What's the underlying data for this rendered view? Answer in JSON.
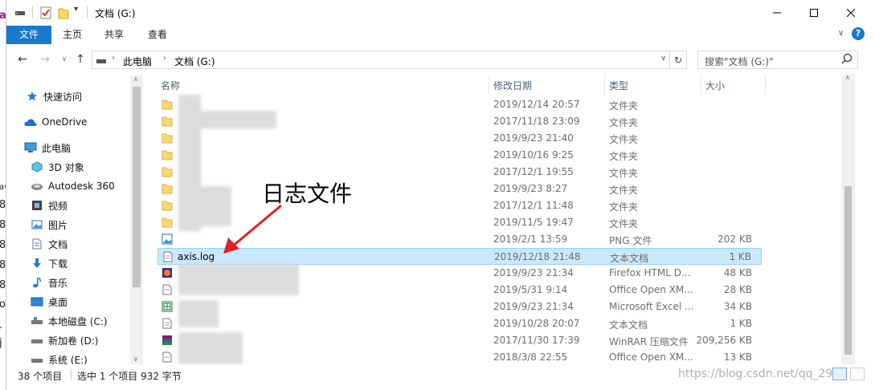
{
  "window": {
    "title": "文档 (G:)",
    "accent": "#1979ca"
  },
  "ribbon": {
    "tabs": [
      "文件",
      "主页",
      "共享",
      "查看"
    ]
  },
  "address": {
    "crumbs": [
      "此电脑",
      "文档 (G:)"
    ],
    "search_placeholder": "搜索\"文档 (G:)\""
  },
  "nav": {
    "items": [
      {
        "label": "快速访问",
        "icon": "star-icon"
      },
      {
        "label": "OneDrive",
        "icon": "cloud-icon"
      },
      {
        "label": "此电脑",
        "icon": "computer-icon"
      },
      {
        "label": "3D 对象",
        "icon": "cube-icon"
      },
      {
        "label": "Autodesk 360",
        "icon": "autodesk-icon"
      },
      {
        "label": "视频",
        "icon": "video-icon"
      },
      {
        "label": "图片",
        "icon": "picture-icon"
      },
      {
        "label": "文档",
        "icon": "document-icon"
      },
      {
        "label": "下载",
        "icon": "download-icon"
      },
      {
        "label": "音乐",
        "icon": "music-icon"
      },
      {
        "label": "桌面",
        "icon": "desktop-icon"
      },
      {
        "label": "本地磁盘 (C:)",
        "icon": "drive-icon"
      },
      {
        "label": "新加卷 (D:)",
        "icon": "drive-icon"
      },
      {
        "label": "系统 (E:)",
        "icon": "drive-icon"
      }
    ]
  },
  "columns": {
    "name": "名称",
    "date": "修改日期",
    "type": "类型",
    "size": "大小"
  },
  "files": [
    {
      "name": "",
      "date": "2019/12/14 20:57",
      "type": "文件夹",
      "size": "",
      "icon": "folder-icon"
    },
    {
      "name": "",
      "date": "2017/11/18 23:09",
      "type": "文件夹",
      "size": "",
      "icon": "folder-icon"
    },
    {
      "name": "",
      "date": "2019/9/23 21:40",
      "type": "文件夹",
      "size": "",
      "icon": "folder-icon"
    },
    {
      "name": "",
      "date": "2019/10/16 9:25",
      "type": "文件夹",
      "size": "",
      "icon": "folder-icon"
    },
    {
      "name": "",
      "date": "2017/12/1 19:55",
      "type": "文件夹",
      "size": "",
      "icon": "folder-icon"
    },
    {
      "name": "",
      "date": "2019/9/23 8:27",
      "type": "文件夹",
      "size": "",
      "icon": "folder-icon"
    },
    {
      "name": "",
      "date": "2017/12/1 11:48",
      "type": "文件夹",
      "size": "",
      "icon": "folder-icon"
    },
    {
      "name": "",
      "date": "2019/11/5 19:47",
      "type": "文件夹",
      "size": "",
      "icon": "folder-icon"
    },
    {
      "name": "",
      "date": "2019/2/1 13:59",
      "type": "PNG 文件",
      "size": "202 KB",
      "icon": "image-file-icon"
    },
    {
      "name": "axis.log",
      "date": "2019/12/18 21:48",
      "type": "文本文档",
      "size": "1 KB",
      "icon": "text-file-icon",
      "selected": true
    },
    {
      "name": "",
      "date": "2019/9/23 21:34",
      "type": "Firefox HTML D...",
      "size": "48 KB",
      "icon": "firefox-file-icon"
    },
    {
      "name": "",
      "date": "2019/5/31 9:14",
      "type": "Office Open XM...",
      "size": "28 KB",
      "icon": "word-file-icon"
    },
    {
      "name": "",
      "date": "2019/9/23 21:34",
      "type": "Microsoft Excel ...",
      "size": "34 KB",
      "icon": "excel-file-icon"
    },
    {
      "name": "",
      "date": "2019/10/28 20:07",
      "type": "文本文档",
      "size": "1 KB",
      "icon": "text-file-icon"
    },
    {
      "name": "",
      "date": "2017/11/30 17:39",
      "type": "WinRAR 压缩文件",
      "size": "209,256 KB",
      "icon": "winrar-file-icon"
    },
    {
      "name": "",
      "date": "2018/3/8 22:55",
      "type": "Office Open XM...",
      "size": "13 KB",
      "icon": "word-file-icon"
    }
  ],
  "annotation": {
    "text": "日志文件",
    "color": "#e02020"
  },
  "status": {
    "count": "38 个项目",
    "selected": "选中 1 个项目 932 字节",
    "watermark": "https://blog.csdn.net/qq_29"
  }
}
